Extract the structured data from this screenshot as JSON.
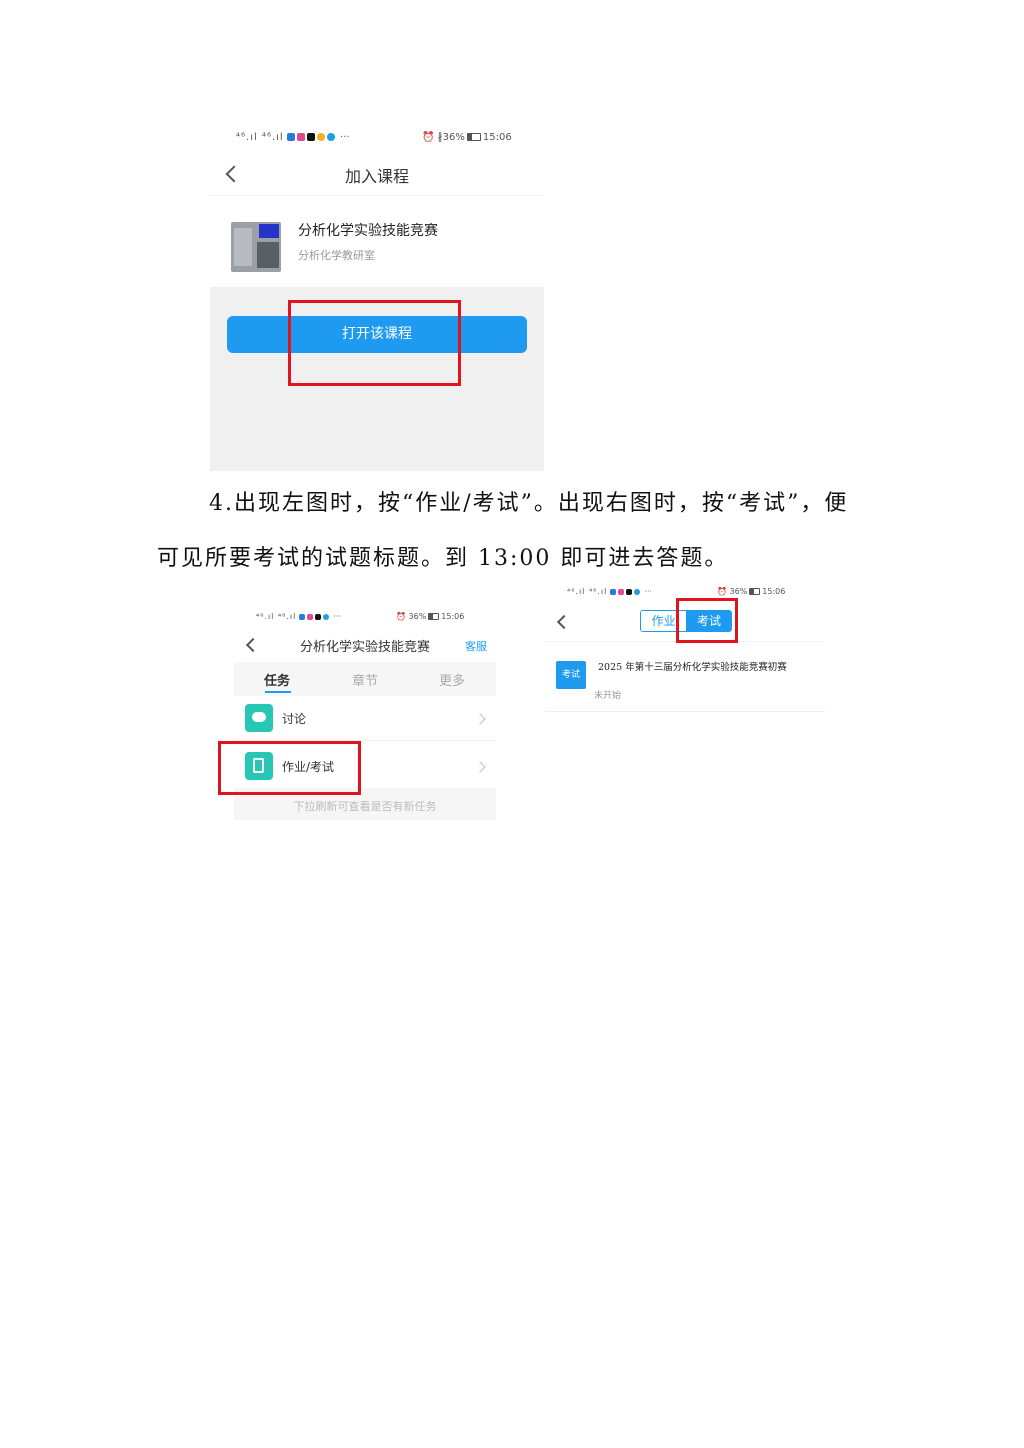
{
  "colors": {
    "accent_blue": "#1E9BF0",
    "red_box": "#E0141E",
    "teal_icon": "#28C6B4",
    "grey_panel": "#F0F0F0"
  },
  "screen1": {
    "status_left": "⁴⁶.ıl ⁴⁶.ıl",
    "status_right": "36%",
    "status_time": "15:06",
    "title": "加入课程",
    "course_name": "分析化学实验技能竞赛",
    "course_teacher": "分析化学教研室",
    "open_button": "打开该课程"
  },
  "instruction": {
    "line1": "4.出现左图时，按“作业/考试”。出现右图时，按“考试”，便",
    "line2": "可见所要考试的试题标题。到 13:00 即可进去答题。"
  },
  "screen2": {
    "status_left": "⁴⁶.ıl ⁴⁶.ıl",
    "status_right": "36%",
    "status_time": "15:06",
    "title": "分析化学实验技能竞赛",
    "service": "客服",
    "tabs": [
      "任务",
      "章节",
      "更多"
    ],
    "items": [
      {
        "label": "讨论",
        "icon": "chat-bubble-icon"
      },
      {
        "label": "作业/考试",
        "icon": "edit-document-icon"
      }
    ],
    "pull_hint": "下拉刷新可查看是否有新任务"
  },
  "screen3": {
    "status_left": "⁴⁶.ıl ⁴⁶.ıl",
    "status_right": "36%",
    "status_time": "15:06",
    "tab_homework": "作业",
    "tab_exam": "考试",
    "exam_badge": "考试",
    "exam_title": "2025 年第十三届分析化学实验技能竞赛初赛",
    "exam_status": "未开始"
  }
}
